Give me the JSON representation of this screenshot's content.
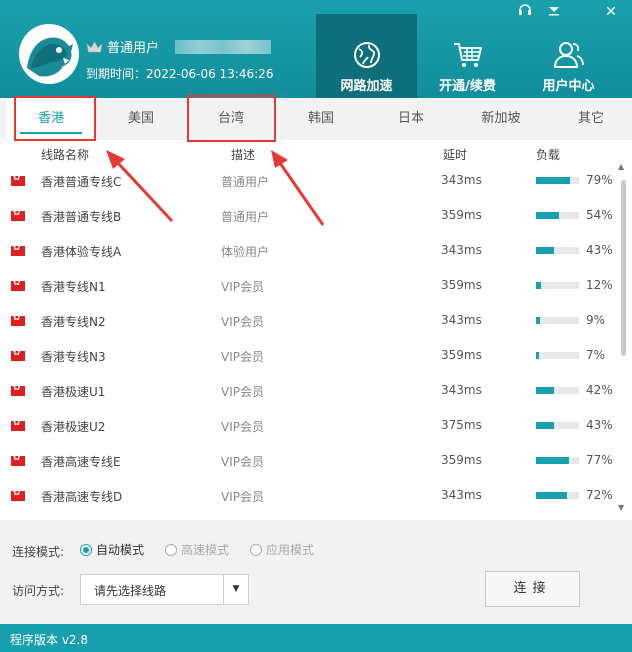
{
  "header": {
    "user_type": "普通用户",
    "expiry": "到期时间：2022-06-06 13:46:26"
  },
  "nav": [
    {
      "label": "网路加速",
      "icon": "globe-icon"
    },
    {
      "label": "开通/续费",
      "icon": "cart-icon"
    },
    {
      "label": "用户中心",
      "icon": "users-icon"
    }
  ],
  "tabs": [
    "香港",
    "美国",
    "台湾",
    "韩国",
    "日本",
    "新加坡",
    "其它"
  ],
  "columns": {
    "name": "线路名称",
    "desc": "描述",
    "latency": "延时",
    "load": "负载"
  },
  "rows": [
    {
      "name": "香港普通专线C",
      "desc": "普通用户",
      "latency": "343ms",
      "load": "79%",
      "load_value": 0.79
    },
    {
      "name": "香港普通专线B",
      "desc": "普通用户",
      "latency": "359ms",
      "load": "54%",
      "load_value": 0.54
    },
    {
      "name": "香港体验专线A",
      "desc": "体验用户",
      "latency": "343ms",
      "load": "43%",
      "load_value": 0.43
    },
    {
      "name": "香港专线N1",
      "desc": "VIP会员",
      "latency": "359ms",
      "load": "12%",
      "load_value": 0.12
    },
    {
      "name": "香港专线N2",
      "desc": "VIP会员",
      "latency": "343ms",
      "load": "9%",
      "load_value": 0.09
    },
    {
      "name": "香港专线N3",
      "desc": "VIP会员",
      "latency": "359ms",
      "load": "7%",
      "load_value": 0.07
    },
    {
      "name": "香港极速U1",
      "desc": "VIP会员",
      "latency": "343ms",
      "load": "42%",
      "load_value": 0.42
    },
    {
      "name": "香港极速U2",
      "desc": "VIP会员",
      "latency": "375ms",
      "load": "43%",
      "load_value": 0.43
    },
    {
      "name": "香港高速专线E",
      "desc": "VIP会员",
      "latency": "359ms",
      "load": "77%",
      "load_value": 0.77
    },
    {
      "name": "香港高速专线D",
      "desc": "VIP会员",
      "latency": "343ms",
      "load": "72%",
      "load_value": 0.72
    }
  ],
  "bottom": {
    "mode_label": "连接模式:",
    "modes": [
      "自动模式",
      "高速模式",
      "应用模式"
    ],
    "access_label": "访问方式:",
    "select_placeholder": "请先选择线路",
    "connect_label": "连接"
  },
  "footer": {
    "version": "程序版本 v2.8"
  },
  "colors": {
    "accent": "#18a0ae",
    "highlight": "#e53935",
    "flag": "#e02020"
  }
}
